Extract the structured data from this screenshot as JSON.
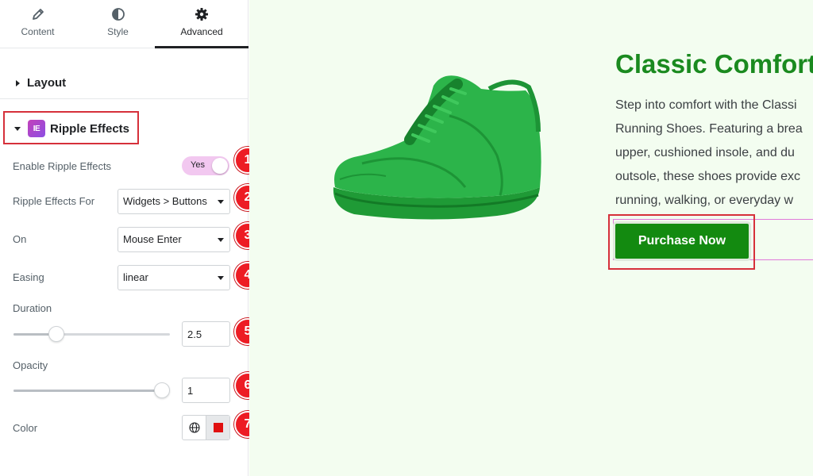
{
  "tabs": [
    {
      "label": "Content",
      "icon": "pencil-icon"
    },
    {
      "label": "Style",
      "icon": "half-circle-icon"
    },
    {
      "label": "Advanced",
      "icon": "gear-icon",
      "active": true
    }
  ],
  "sections": {
    "layout": {
      "title": "Layout",
      "expanded": false
    },
    "ripple": {
      "title": "Ripple Effects",
      "expanded": true,
      "logo_text": "IE"
    }
  },
  "controls": {
    "enable": {
      "label": "Enable Ripple Effects",
      "value": "Yes"
    },
    "effects_for": {
      "label": "Ripple Effects For",
      "value": "Widgets > Buttons"
    },
    "on": {
      "label": "On",
      "value": "Mouse Enter"
    },
    "easing": {
      "label": "Easing",
      "value": "linear"
    },
    "duration": {
      "label": "Duration",
      "value": "2.5",
      "slider_fraction": 0.25
    },
    "opacity": {
      "label": "Opacity",
      "value": "1",
      "slider_fraction": 1.0
    },
    "color": {
      "label": "Color",
      "swatch": "#e01010"
    }
  },
  "badges": [
    "1",
    "2",
    "3",
    "4",
    "5",
    "6",
    "7"
  ],
  "collapse_glyph": "‹",
  "product": {
    "title": "Classic Comfort",
    "description_lines": [
      "Step into comfort with the Classi",
      "Running Shoes. Featuring a brea",
      "upper, cushioned insole, and du",
      "outsole, these shoes provide exc",
      "running, walking, or everyday w"
    ],
    "button_label": "Purchase Now"
  },
  "colors": {
    "title_green": "#1a8a1f",
    "button_green": "#138a10",
    "preview_bg": "#f3fdf0",
    "badge_red": "#ed1c24",
    "highlight_red": "#d6303a",
    "toggle_pink": "#f2c8f0"
  }
}
